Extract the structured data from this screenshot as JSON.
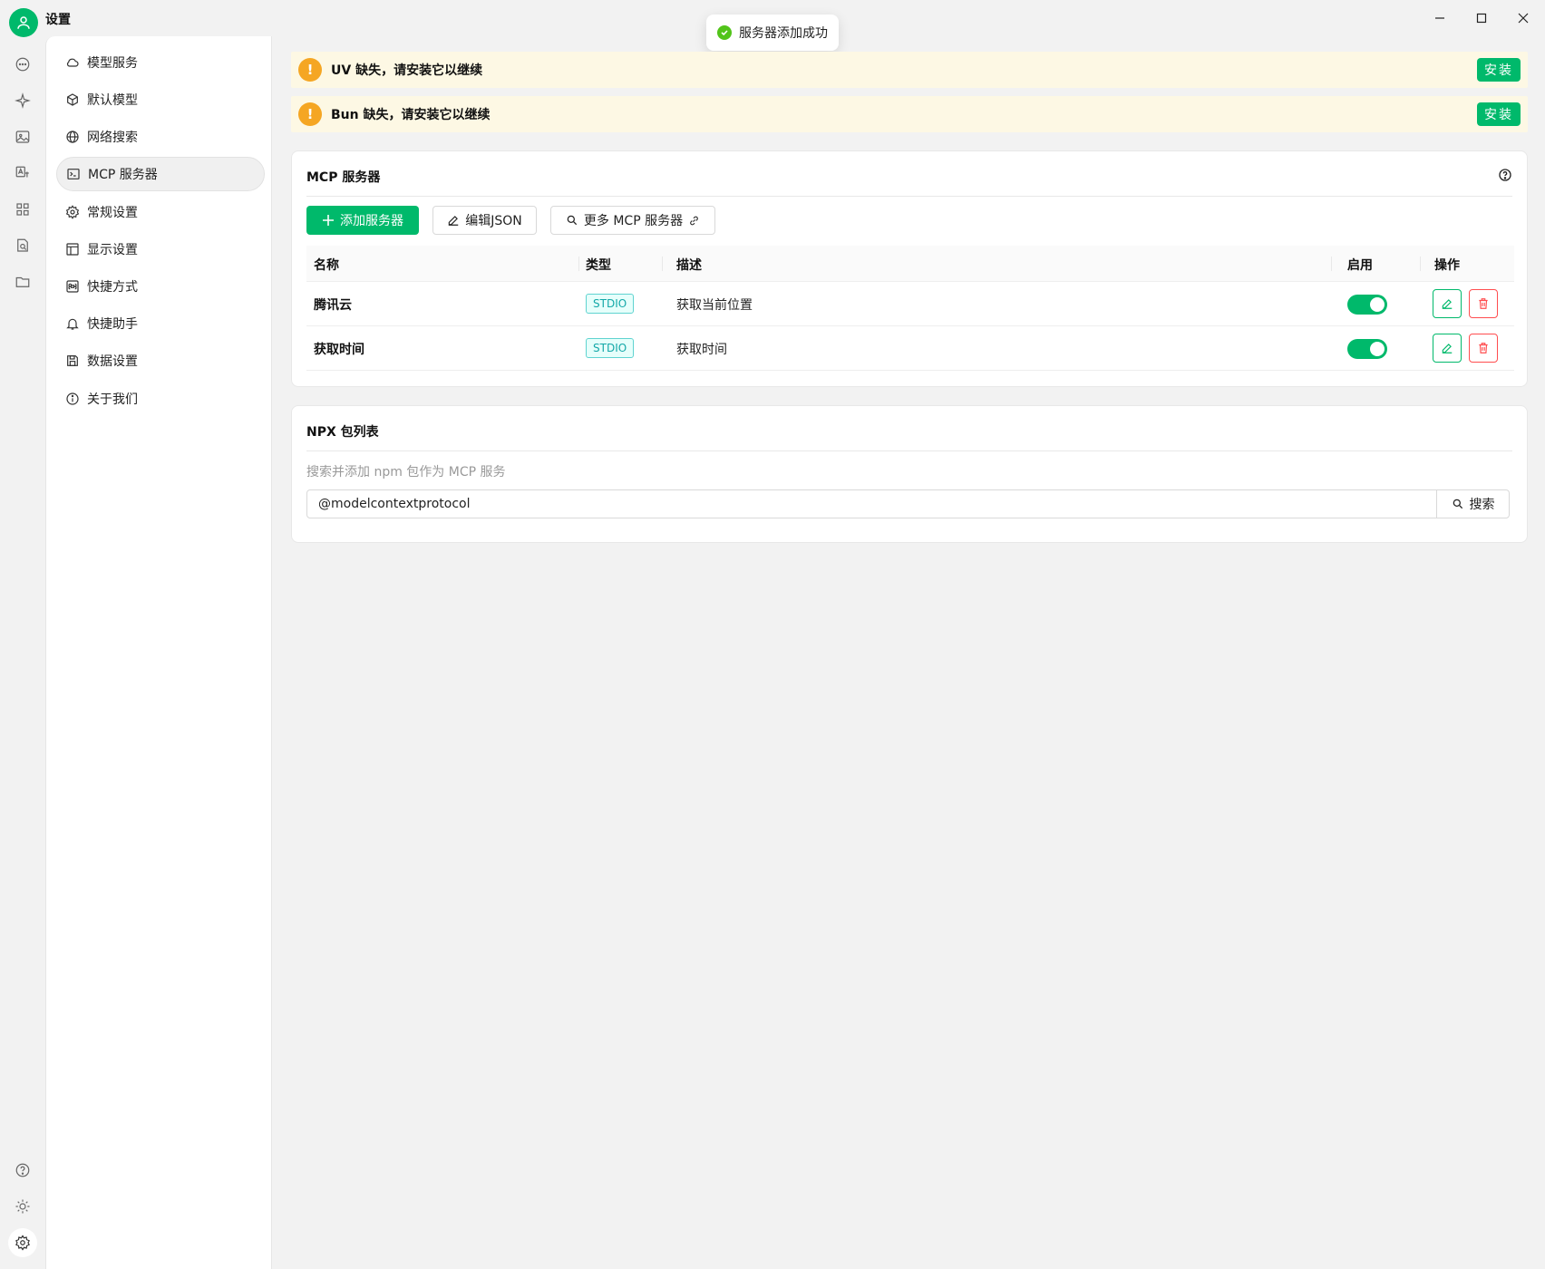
{
  "window": {
    "title": "设置"
  },
  "toast": {
    "message": "服务器添加成功"
  },
  "rail": {
    "icons": [
      "chat-icon",
      "sparkle-icon",
      "image-icon",
      "translate-icon",
      "apps-icon",
      "search-doc-icon",
      "folder-icon"
    ],
    "bottom_icons": [
      "help-icon",
      "theme-icon",
      "settings-icon"
    ]
  },
  "nav": {
    "items": [
      {
        "label": "模型服务",
        "icon": "cloud-icon"
      },
      {
        "label": "默认模型",
        "icon": "cube-icon"
      },
      {
        "label": "网络搜索",
        "icon": "globe-icon"
      },
      {
        "label": "MCP 服务器",
        "icon": "terminal-icon",
        "active": true
      },
      {
        "label": "常规设置",
        "icon": "gear-icon"
      },
      {
        "label": "显示设置",
        "icon": "layout-icon"
      },
      {
        "label": "快捷方式",
        "icon": "command-icon"
      },
      {
        "label": "快捷助手",
        "icon": "bell-icon"
      },
      {
        "label": "数据设置",
        "icon": "save-icon"
      },
      {
        "label": "关于我们",
        "icon": "info-icon"
      }
    ]
  },
  "warnings": [
    {
      "text": "UV 缺失，请安装它以继续",
      "button": "安装"
    },
    {
      "text": "Bun 缺失，请安装它以继续",
      "button": "安装"
    }
  ],
  "mcp": {
    "title": "MCP 服务器",
    "add_button": "添加服务器",
    "edit_json_button": "编辑JSON",
    "more_button": "更多 MCP 服务器",
    "columns": [
      "名称",
      "类型",
      "描述",
      "启用",
      "操作"
    ],
    "rows": [
      {
        "name": "腾讯云",
        "type": "STDIO",
        "description": "获取当前位置",
        "enabled": true
      },
      {
        "name": "获取时间",
        "type": "STDIO",
        "description": "获取时间",
        "enabled": true
      }
    ]
  },
  "npx": {
    "title": "NPX 包列表",
    "hint": "搜索并添加 npm 包作为 MCP 服务",
    "search_value": "@modelcontextprotocol",
    "search_button": "搜索"
  },
  "colors": {
    "accent": "#00b96b",
    "warning": "#f5a623",
    "danger": "#ff4d4f",
    "tag": "#13a8a8"
  }
}
